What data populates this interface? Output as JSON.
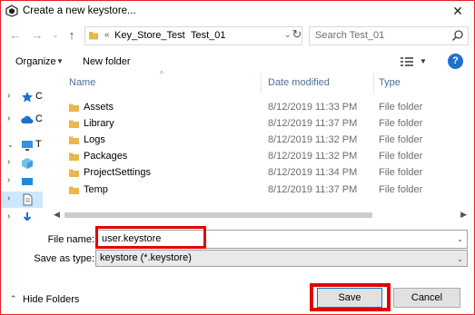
{
  "window": {
    "title": "Create a new keystore...",
    "close_glyph": "✕"
  },
  "address": {
    "overflow": "«",
    "crumbs": [
      "Key_Store_Test",
      "Test_01"
    ],
    "search_placeholder": "Search Test_01"
  },
  "toolbar": {
    "organize_label": "Organize",
    "new_folder_label": "New folder",
    "help_glyph": "?"
  },
  "filelist": {
    "columns": [
      "Name",
      "Date modified",
      "Type"
    ],
    "rows": [
      {
        "name": "Assets",
        "date": "8/12/2019 11:33 PM",
        "type": "File folder"
      },
      {
        "name": "Library",
        "date": "8/12/2019 11:37 PM",
        "type": "File folder"
      },
      {
        "name": "Logs",
        "date": "8/12/2019 11:32 PM",
        "type": "File folder"
      },
      {
        "name": "Packages",
        "date": "8/12/2019 11:32 PM",
        "type": "File folder"
      },
      {
        "name": "ProjectSettings",
        "date": "8/12/2019 11:34 PM",
        "type": "File folder"
      },
      {
        "name": "Temp",
        "date": "8/12/2019 11:37 PM",
        "type": "File folder"
      }
    ]
  },
  "form": {
    "file_name_label": "File name:",
    "file_name_value": "user.keystore",
    "save_as_type_label": "Save as type:",
    "save_as_type_value": "keystore (*.keystore)"
  },
  "footer": {
    "hide_folders_label": "Hide Folders",
    "save_label": "Save",
    "cancel_label": "Cancel"
  },
  "colors": {
    "accent": "#0078d7",
    "highlight": "#e10000",
    "folder": "#e8b84a",
    "selection": "#cce8ff"
  }
}
